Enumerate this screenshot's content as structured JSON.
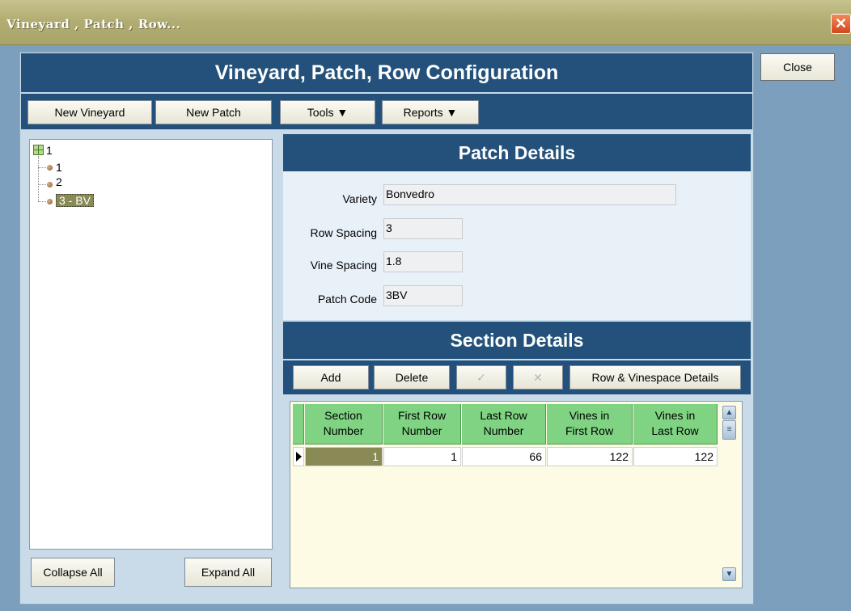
{
  "window": {
    "title": "Vineyard , Patch , Row..."
  },
  "close_label": "Close",
  "header": {
    "title": "Vineyard, Patch, Row Configuration"
  },
  "toolbar": {
    "new_vineyard": "New Vineyard",
    "new_patch": "New Patch",
    "tools": "Tools ▼",
    "reports": "Reports ▼"
  },
  "tree": {
    "root": "1",
    "children": [
      "1",
      "2",
      "3 - BV"
    ]
  },
  "patch": {
    "title": "Patch Details",
    "variety_label": "Variety",
    "variety_value": "Bonvedro",
    "row_spacing_label": "Row Spacing",
    "row_spacing_value": "3",
    "vine_spacing_label": "Vine Spacing",
    "vine_spacing_value": "1.8",
    "patch_code_label": "Patch Code",
    "patch_code_value": "3BV"
  },
  "sections": {
    "title": "Section Details",
    "add": "Add",
    "delete": "Delete",
    "confirm_icon": "✓",
    "cancel_icon": "✕",
    "row_vinespace": "Row & Vinespace Details",
    "columns": [
      {
        "line1": "Section",
        "line2": "Number"
      },
      {
        "line1": "First Row",
        "line2": "Number"
      },
      {
        "line1": "Last Row",
        "line2": "Number"
      },
      {
        "line1": "Vines in",
        "line2": "First Row"
      },
      {
        "line1": "Vines in",
        "line2": "Last Row"
      }
    ],
    "rows": [
      [
        "1",
        "1",
        "66",
        "122",
        "122"
      ]
    ]
  },
  "tree_buttons": {
    "collapse": "Collapse All",
    "expand": "Expand All"
  }
}
